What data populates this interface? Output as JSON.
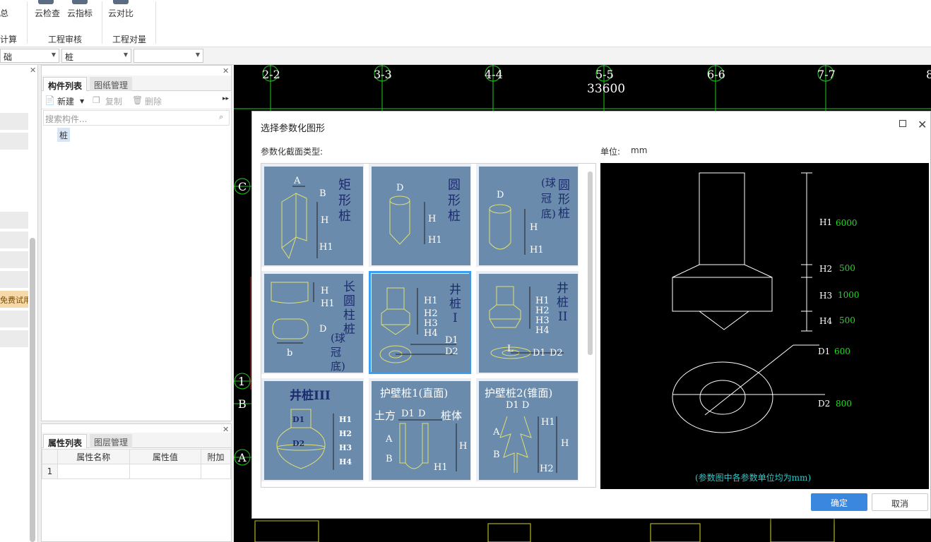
{
  "ribbon": {
    "partial_left_label": "总",
    "buttons": [
      {
        "label": "云检查"
      },
      {
        "label": "云指标"
      },
      {
        "label": "云对比"
      }
    ],
    "groups": [
      {
        "label": "计算"
      },
      {
        "label": "工程审核"
      },
      {
        "label": "工程对量"
      }
    ]
  },
  "selectors": {
    "category": "础",
    "type": "桩",
    "extra": ""
  },
  "left_panel": {
    "trial_badge": "免费试用"
  },
  "component_panel": {
    "tabs": [
      "构件列表",
      "图纸管理"
    ],
    "toolbar": {
      "new": "新建",
      "copy": "复制",
      "delete": "删除"
    },
    "search_placeholder": "搜索构件...",
    "tree_item": "桩"
  },
  "property_panel": {
    "tabs": [
      "属性列表",
      "图层管理"
    ],
    "columns": [
      "属性名称",
      "属性值",
      "附加"
    ],
    "rows": [
      {
        "index": "1",
        "name": "",
        "value": "",
        "extra": ""
      }
    ]
  },
  "drawing": {
    "axis_labels": [
      "2-2",
      "3-3",
      "4-4",
      "5-5",
      "6-6",
      "7-7",
      "8"
    ],
    "dimension": "33600",
    "row_labels": [
      "C",
      "1",
      "B",
      "A"
    ]
  },
  "dialog": {
    "title": "选择参数化图形",
    "section_label": "参数化截面类型:",
    "unit_label": "单位:",
    "unit_value": "mm",
    "shapes": [
      {
        "name": "矩形桩"
      },
      {
        "name": "圆形桩"
      },
      {
        "name": "圆形桩(球冠底)"
      },
      {
        "name": "长圆柱桩(球冠底)"
      },
      {
        "name": "井桩I",
        "selected": true
      },
      {
        "name": "井桩II"
      },
      {
        "name": "井桩III"
      },
      {
        "name": "护壁桩1(直面)"
      },
      {
        "name": "护壁桩2(锥面)"
      }
    ],
    "params": [
      {
        "name": "H1",
        "value": "6000"
      },
      {
        "name": "H2",
        "value": "500"
      },
      {
        "name": "H3",
        "value": "1000"
      },
      {
        "name": "H4",
        "value": "500"
      },
      {
        "name": "D1",
        "value": "600"
      },
      {
        "name": "D2",
        "value": "800"
      }
    ],
    "note": "(参数图中各参数单位均为mm)",
    "ok_label": "确定",
    "cancel_label": "取消",
    "colors": {
      "thumb_bg": "#6a8bab",
      "selected_border": "#3a9ff0",
      "param_value": "#22dd22",
      "note": "#22cccc"
    }
  }
}
